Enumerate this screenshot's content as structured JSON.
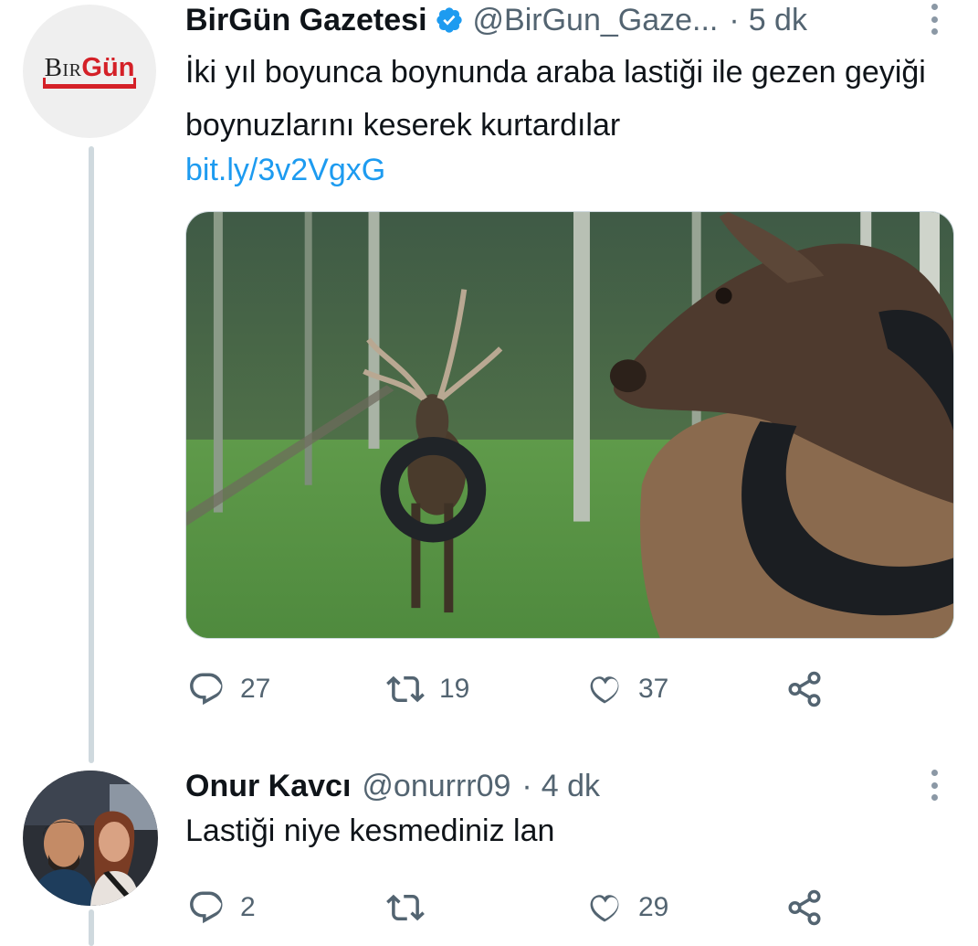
{
  "tweet": {
    "author_name": "BirGün Gazetesi",
    "author_handle": "@BirGun_Gaze...",
    "separator": "·",
    "time": "5 dk",
    "avatar_logo": {
      "part1": "Bir",
      "part2": "Gün"
    },
    "text": "İki yıl boyunca boynunda araba lastiği ile gezen geyiği boynuzlarını keserek kurtardılar",
    "link": "bit.ly/3v2VgxG",
    "image_alt": "two deer with car tires around their necks in a forest",
    "metrics": {
      "replies": "27",
      "retweets": "19",
      "likes": "37"
    },
    "verified": true
  },
  "reply": {
    "author_name": "Onur Kavcı",
    "author_handle": "@onurrr09",
    "separator": "·",
    "time": "4 dk",
    "text": "Lastiği niye kesmediniz lan",
    "metrics": {
      "replies": "2",
      "retweets": "",
      "likes": "29"
    }
  },
  "colors": {
    "link_blue": "#1d9bf0",
    "verified_blue": "#1d9bf0",
    "secondary_text": "#536471",
    "thread_line": "#cfd9de",
    "brand_red": "#d42027"
  },
  "icons": [
    "verified-badge-icon",
    "more-options-icon",
    "reply-icon",
    "retweet-icon",
    "like-icon",
    "share-icon"
  ]
}
